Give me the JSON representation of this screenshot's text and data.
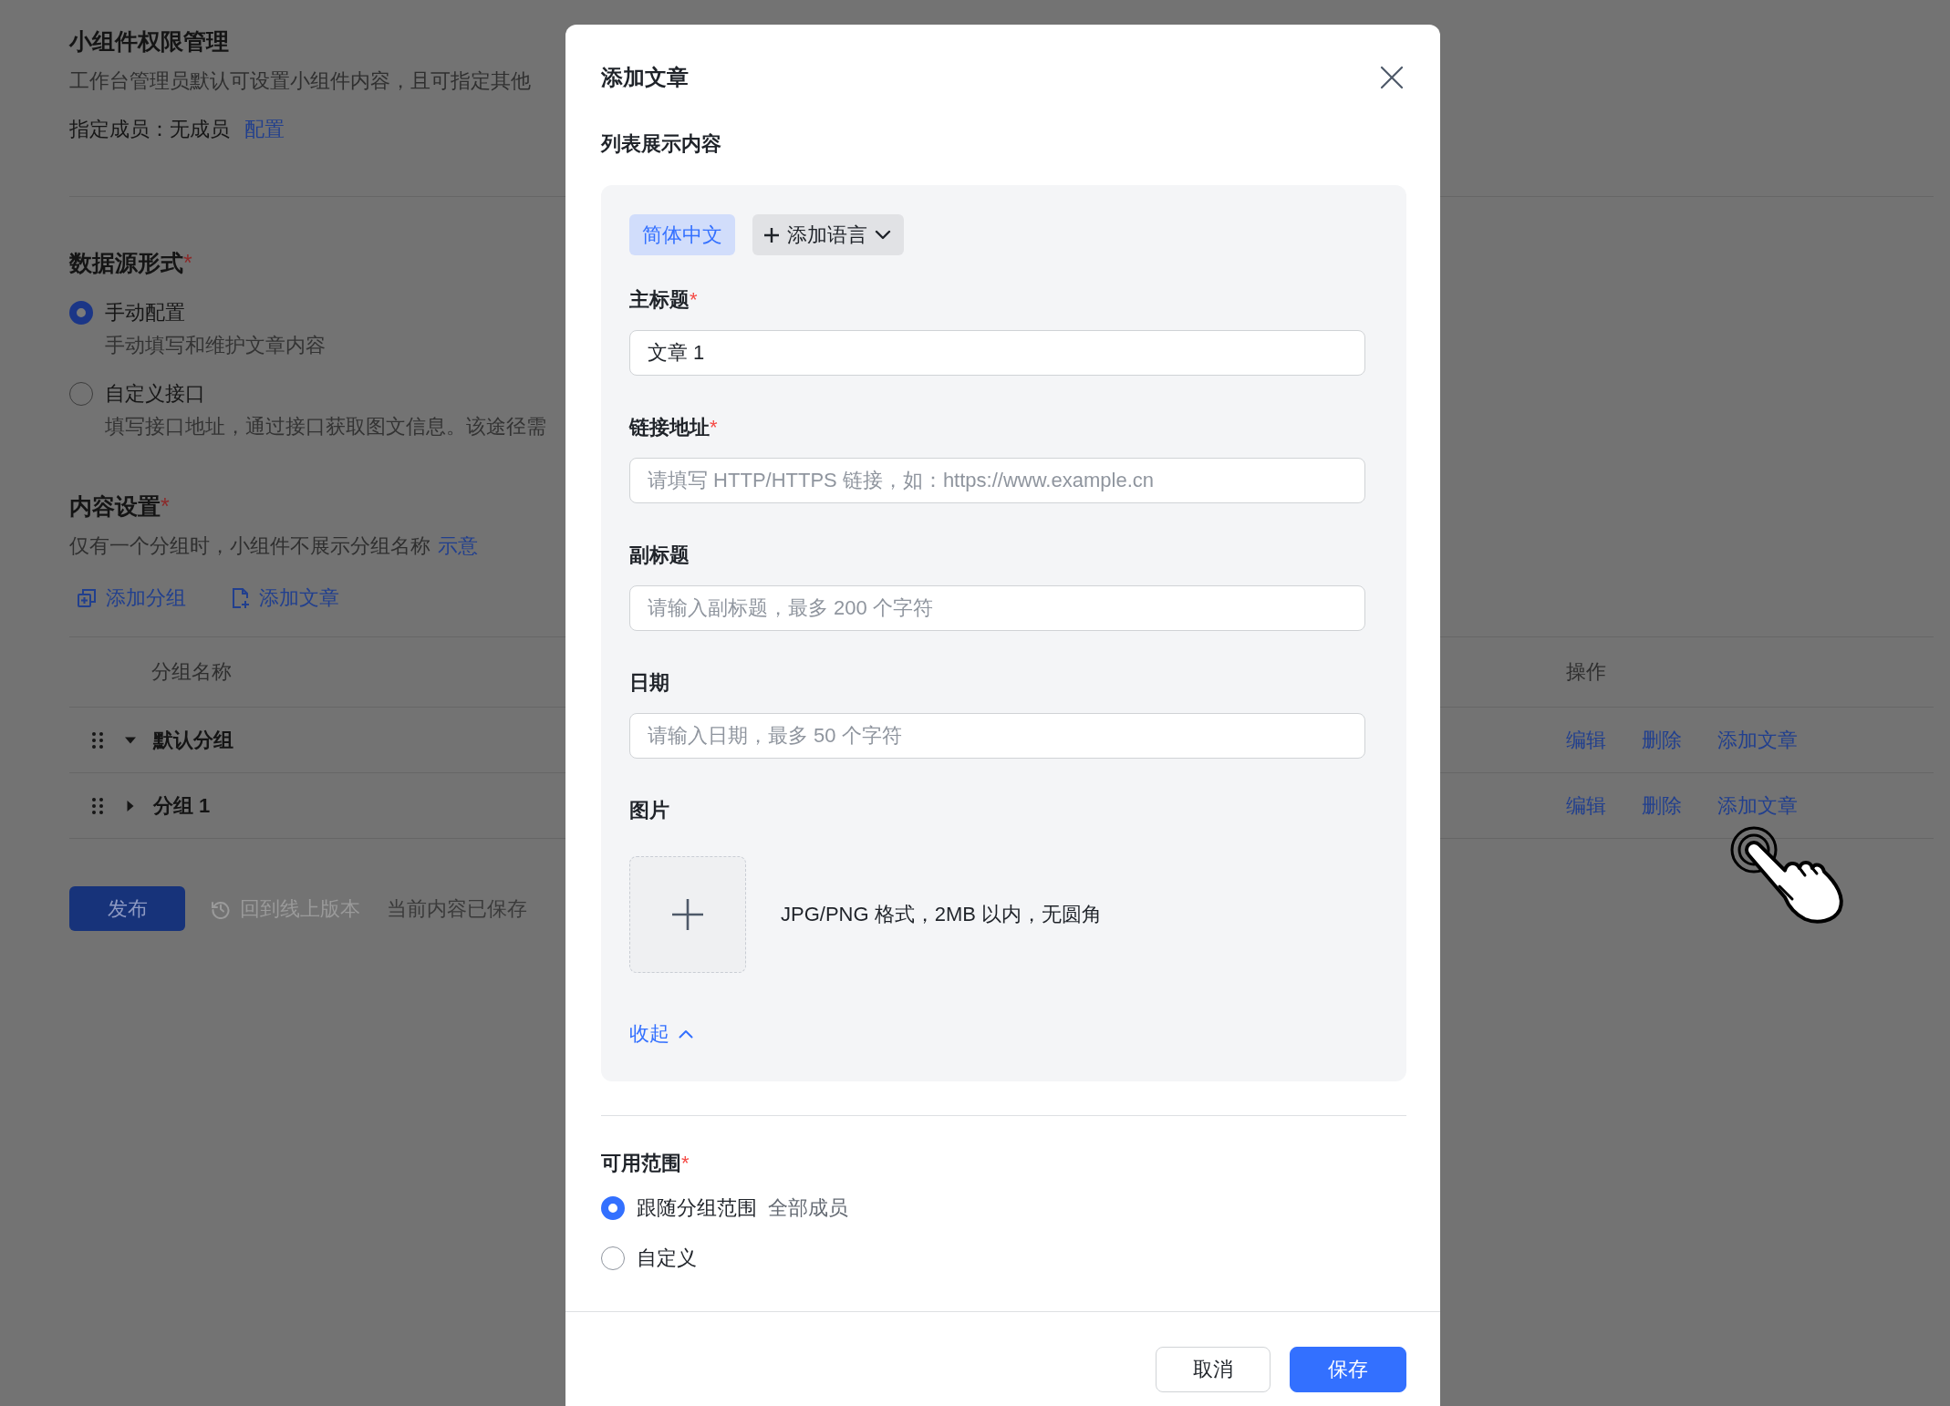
{
  "settings_page": {
    "title": "小组件权限管理",
    "description": "工作台管理员默认可设置小组件内容，且可指定其他",
    "members": {
      "text": "指定成员：无成员",
      "link": "配置"
    },
    "data_source": {
      "heading": "数据源形式",
      "mark": "*",
      "options": [
        {
          "label": "手动配置",
          "hint": "手动填写和维护文章内容",
          "selected": true
        },
        {
          "label": "自定义接口",
          "hint": "填写接口地址，通过接口获取图文信息。该途径需",
          "selected": false
        }
      ]
    },
    "content": {
      "heading": "内容设置",
      "mark": "*",
      "note": "仅有一个分组时，小组件不展示分组名称",
      "note_link": "示意",
      "actions": [
        {
          "kind": "group",
          "label": "添加分组"
        },
        {
          "kind": "article",
          "label": "添加文章"
        }
      ]
    },
    "table": {
      "columns": [
        "分组名称",
        "操作"
      ],
      "rows": [
        {
          "name": "默认分组",
          "expanded": true,
          "actions": [
            "编辑",
            "删除",
            "添加文章"
          ]
        },
        {
          "name": "分组 1",
          "expanded": false,
          "actions": [
            "编辑",
            "删除",
            "添加文章"
          ]
        }
      ]
    },
    "footer": {
      "publish": "发布",
      "revert": {
        "label": "回到线上版本",
        "disabled": true
      },
      "status": "当前内容已保存"
    }
  },
  "dialog": {
    "title": "添加文章",
    "section": "列表展示内容",
    "languages": [
      {
        "label": "简体中文",
        "selected": true
      }
    ],
    "add_language": "添加语言",
    "fields": [
      {
        "kind": "text",
        "label": "主标题",
        "mark": "*",
        "value": "文章 1"
      },
      {
        "kind": "text",
        "label": "链接地址",
        "mark": "*",
        "placeholder": "请填写 HTTP/HTTPS 链接，如：https://www.example.cn"
      },
      {
        "kind": "text",
        "label": "副标题",
        "placeholder": "请输入副标题，最多 200 个字符"
      },
      {
        "kind": "text",
        "label": "日期",
        "placeholder": "请输入日期，最多 50 个字符"
      },
      {
        "kind": "image",
        "label": "图片",
        "hint": "JPG/PNG 格式，2MB 以内，无圆角"
      }
    ],
    "collapse": "收起",
    "scope": {
      "label": "可用范围",
      "mark": "*",
      "options": [
        {
          "label": "跟随分组范围",
          "note": "全部成员",
          "selected": true
        },
        {
          "label": "自定义",
          "selected": false
        }
      ]
    },
    "buttons": [
      {
        "kind": "secondary",
        "label": "取消"
      },
      {
        "kind": "primary",
        "label": "保存"
      }
    ]
  }
}
